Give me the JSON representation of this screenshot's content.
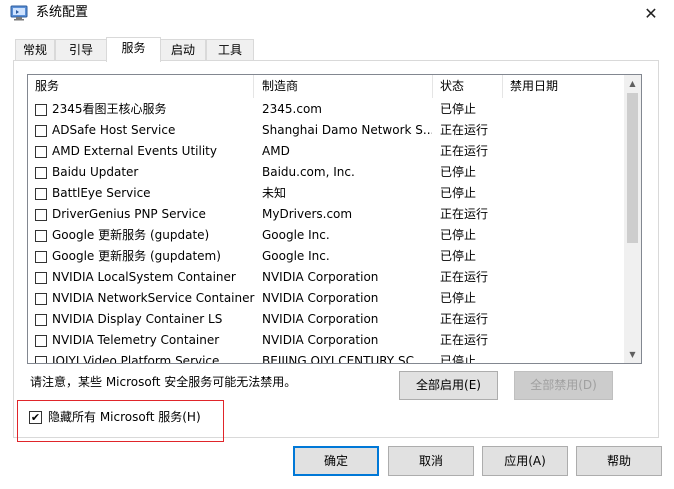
{
  "window": {
    "title": "系统配置",
    "icon": "msconfig-icon",
    "close_glyph": "✕"
  },
  "tabs": [
    {
      "label": "常规"
    },
    {
      "label": "引导"
    },
    {
      "label": "服务",
      "active": true
    },
    {
      "label": "启动"
    },
    {
      "label": "工具"
    }
  ],
  "services": {
    "columns": [
      "服务",
      "制造商",
      "状态",
      "禁用日期"
    ],
    "rows": [
      {
        "name": "2345看图王核心服务",
        "manufacturer": "2345.com",
        "status": "已停止",
        "disabled_date": ""
      },
      {
        "name": "ADSafe Host Service",
        "manufacturer": "Shanghai Damo Network S...",
        "status": "正在运行",
        "disabled_date": ""
      },
      {
        "name": "AMD External Events Utility",
        "manufacturer": "AMD",
        "status": "正在运行",
        "disabled_date": ""
      },
      {
        "name": "Baidu Updater",
        "manufacturer": "Baidu.com, Inc.",
        "status": "已停止",
        "disabled_date": ""
      },
      {
        "name": "BattlEye Service",
        "manufacturer": "未知",
        "status": "已停止",
        "disabled_date": ""
      },
      {
        "name": "DriverGenius PNP Service",
        "manufacturer": "MyDrivers.com",
        "status": "正在运行",
        "disabled_date": ""
      },
      {
        "name": "Google 更新服务 (gupdate)",
        "manufacturer": "Google Inc.",
        "status": "已停止",
        "disabled_date": ""
      },
      {
        "name": "Google 更新服务 (gupdatem)",
        "manufacturer": "Google Inc.",
        "status": "已停止",
        "disabled_date": ""
      },
      {
        "name": "NVIDIA LocalSystem Container",
        "manufacturer": "NVIDIA Corporation",
        "status": "正在运行",
        "disabled_date": ""
      },
      {
        "name": "NVIDIA NetworkService Container",
        "manufacturer": "NVIDIA Corporation",
        "status": "已停止",
        "disabled_date": ""
      },
      {
        "name": "NVIDIA Display Container LS",
        "manufacturer": "NVIDIA Corporation",
        "status": "正在运行",
        "disabled_date": ""
      },
      {
        "name": "NVIDIA Telemetry Container",
        "manufacturer": "NVIDIA Corporation",
        "status": "正在运行",
        "disabled_date": ""
      },
      {
        "name": "IQIYI Video Platform Service",
        "manufacturer": "BEIJING QIYI CENTURY SC...",
        "status": "已停止",
        "disabled_date": ""
      }
    ]
  },
  "notice": "请注意，某些 Microsoft 安全服务可能无法禁用。",
  "buttons": {
    "enable_all": "全部启用(E)",
    "disable_all": "全部禁用(D)",
    "ok": "确定",
    "cancel": "取消",
    "apply": "应用(A)",
    "help": "帮助"
  },
  "hide_ms": {
    "label": "隐藏所有 Microsoft 服务(H)",
    "checked": true,
    "check_glyph": "✔"
  },
  "colors": {
    "highlight_border": "#e0252a",
    "default_button_border": "#0078d7"
  }
}
